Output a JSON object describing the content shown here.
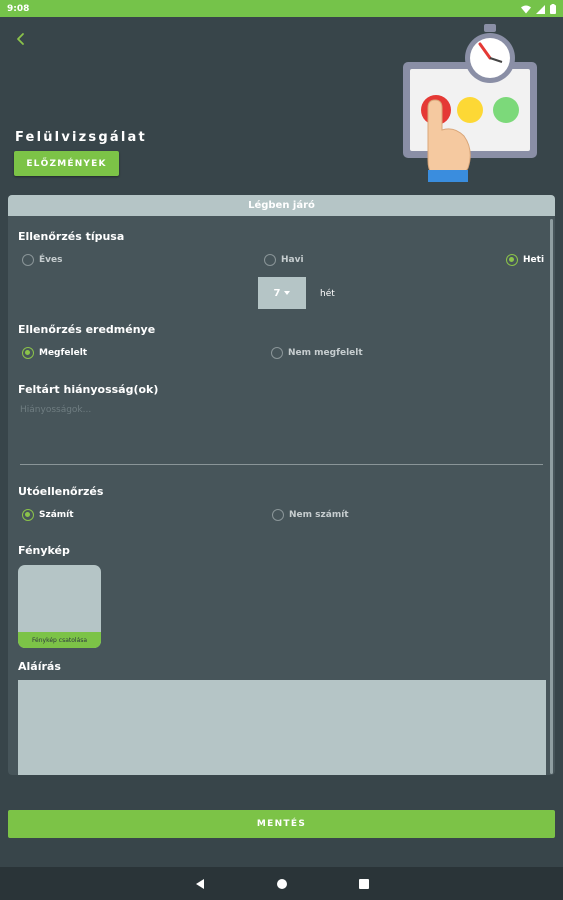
{
  "status_bar": {
    "time": "9:08"
  },
  "header": {
    "title": "Felülvizsgálat",
    "history_button": "ELŐZMÉNYEK"
  },
  "card": {
    "header": "Légben járó",
    "inspection_type": {
      "label": "Ellenőrzés típusa",
      "options": [
        {
          "label": "Éves",
          "selected": false
        },
        {
          "label": "Havi",
          "selected": false
        },
        {
          "label": "Heti",
          "selected": true
        }
      ],
      "week_value": "7",
      "week_unit": "hét"
    },
    "result": {
      "label": "Ellenőrzés eredménye",
      "options": [
        {
          "label": "Megfelelt",
          "selected": true
        },
        {
          "label": "Nem megfelelt",
          "selected": false
        }
      ]
    },
    "defects": {
      "label": "Feltárt hiányosság(ok)",
      "placeholder": "Hiányosságok..."
    },
    "followup": {
      "label": "Utóellenőrzés",
      "options": [
        {
          "label": "Számít",
          "selected": true
        },
        {
          "label": "Nem számít",
          "selected": false
        }
      ]
    },
    "photo": {
      "label": "Fénykép",
      "add_label": "Fénykép csatolása"
    },
    "signature": {
      "label": "Aláírás"
    }
  },
  "save_button": "MENTÉS",
  "colors": {
    "accent": "#7cc347",
    "background": "#38454a",
    "card": "#47555a",
    "panel": "#b5c5c6"
  },
  "icons": [
    "wifi-icon",
    "signal-icon",
    "battery-icon",
    "back-arrow-icon",
    "stopwatch-icon",
    "nav-back-icon",
    "nav-home-icon",
    "nav-recents-icon"
  ]
}
